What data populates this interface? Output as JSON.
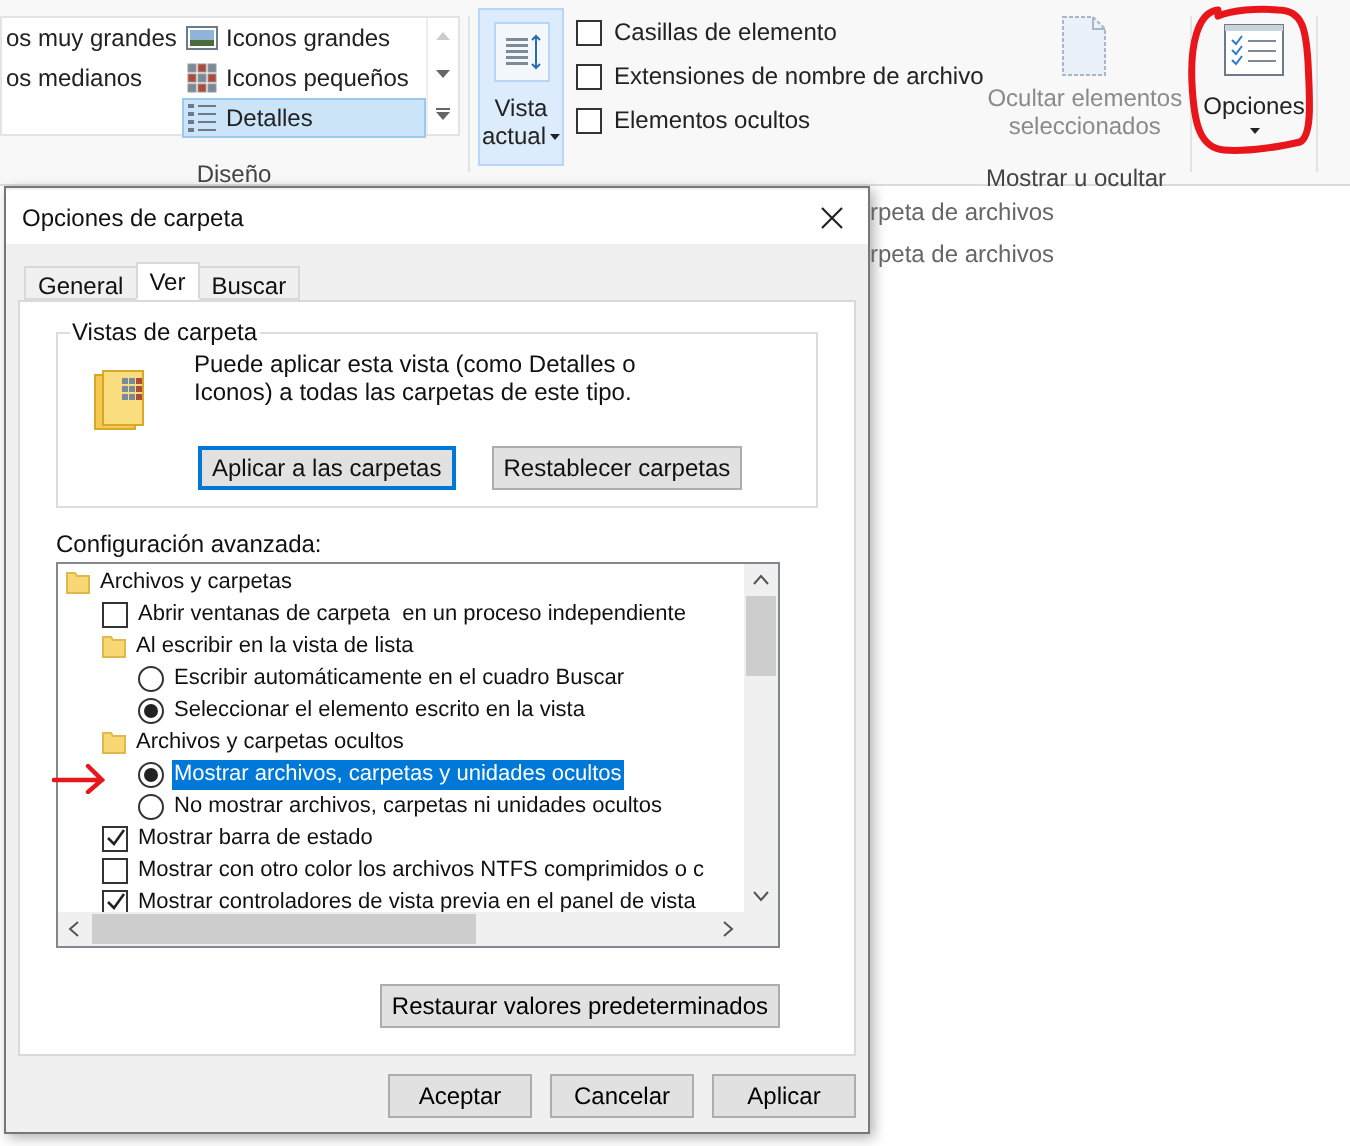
{
  "ribbon": {
    "layout": {
      "gallery": [
        {
          "label": "os muy grandes",
          "kind": "plain",
          "selected": false
        },
        {
          "label": "Iconos grandes",
          "kind": "large",
          "selected": false
        },
        {
          "label": "os medianos",
          "kind": "plain",
          "selected": false
        },
        {
          "label": "Iconos pequeños",
          "kind": "small",
          "selected": false
        },
        {
          "label": "Detalles",
          "kind": "details",
          "selected": true
        }
      ],
      "group_label": "Diseño"
    },
    "current_view": {
      "lines": [
        "Vista",
        "actual"
      ]
    },
    "show_hide": {
      "checkboxes": [
        {
          "label": "Casillas de elemento",
          "checked": false
        },
        {
          "label": "Extensiones de nombre de archivo",
          "checked": false
        },
        {
          "label": "Elementos ocultos",
          "checked": false
        }
      ],
      "hide_selected": {
        "lines": [
          "Ocultar elementos",
          "seleccionados"
        ],
        "disabled": true
      },
      "group_label": "Mostrar u ocultar"
    },
    "options": {
      "label": "Opciones"
    }
  },
  "background_rows": [
    "rpeta de archivos",
    "rpeta de archivos"
  ],
  "dialog": {
    "title": "Opciones de carpeta",
    "tabs": [
      {
        "label": "General",
        "selected": false
      },
      {
        "label": "Ver",
        "selected": true
      },
      {
        "label": "Buscar",
        "selected": false
      }
    ],
    "folder_views": {
      "legend": "Vistas de carpeta",
      "description": "Puede aplicar esta vista (como Detalles o Iconos) a todas las carpetas de este tipo.",
      "buttons": [
        {
          "label": "Aplicar a las carpetas",
          "focused": true
        },
        {
          "label": "Restablecer carpetas",
          "focused": false
        }
      ]
    },
    "advanced_label": "Configuración avanzada:",
    "tree": [
      {
        "kind": "folder",
        "label": "Archivos y carpetas",
        "selected": false,
        "children": [
          {
            "kind": "checkbox",
            "label": "Abrir ventanas de carpeta  en un proceso independiente",
            "checked": false,
            "selected": false
          },
          {
            "kind": "folder",
            "label": "Al escribir en la vista de lista",
            "selected": false,
            "children": [
              {
                "kind": "radio",
                "label": "Escribir automáticamente en el cuadro Buscar",
                "checked": false,
                "selected": false
              },
              {
                "kind": "radio",
                "label": "Seleccionar el elemento escrito en la vista",
                "checked": true,
                "selected": false
              }
            ]
          },
          {
            "kind": "folder",
            "label": "Archivos y carpetas ocultos",
            "selected": false,
            "children": [
              {
                "kind": "radio",
                "label": "Mostrar archivos, carpetas y unidades ocultos",
                "checked": true,
                "selected": true
              },
              {
                "kind": "radio",
                "label": "No mostrar archivos, carpetas ni unidades ocultos",
                "checked": false,
                "selected": false
              }
            ]
          },
          {
            "kind": "checkbox",
            "label": "Mostrar barra de estado",
            "checked": true,
            "selected": false
          },
          {
            "kind": "checkbox",
            "label": "Mostrar con otro color los archivos NTFS comprimidos o c",
            "checked": false,
            "selected": false
          },
          {
            "kind": "checkbox",
            "label": "Mostrar controladores de vista previa en el panel de vista",
            "checked": true,
            "selected": false
          }
        ]
      }
    ],
    "restore_button": "Restaurar valores predeterminados",
    "footer_buttons": [
      "Aceptar",
      "Cancelar",
      "Aplicar"
    ]
  }
}
